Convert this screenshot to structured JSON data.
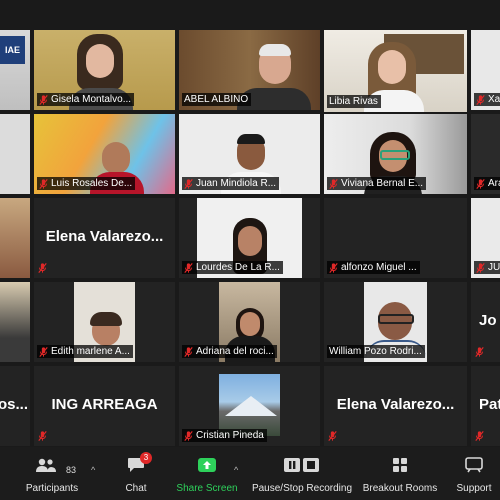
{
  "tiles": {
    "r1c0": {
      "label": ""
    },
    "r1c1": {
      "label": "Gisela Montalvo..."
    },
    "r1c2": {
      "label": "ABEL ALBINO"
    },
    "r1c3": {
      "label": "Libia Rivas"
    },
    "r1c4": {
      "label": "Xa"
    },
    "r2c1": {
      "label": "Luis Rosales De..."
    },
    "r2c2": {
      "label": "Juan Mindiola R..."
    },
    "r2c3": {
      "label": "Viviana Bernal E..."
    },
    "r2c4": {
      "label": "Ara"
    },
    "r3c1": {
      "name": "Elena Valarezo..."
    },
    "r3c2": {
      "label": "Lourdes De La R..."
    },
    "r3c3": {
      "label": "alfonzo Miguel ..."
    },
    "r3c4": {
      "label": "JU"
    },
    "r4c1": {
      "label": "Edith marlene A..."
    },
    "r4c2": {
      "label": "Adriana del roci..."
    },
    "r4c3": {
      "label": "William Pozo Rodri..."
    },
    "r4c4": {
      "name": "Jo"
    },
    "r5c0": {
      "name": "os..."
    },
    "r5c1": {
      "name": "ING ARREAGA"
    },
    "r5c2": {
      "label": "Cristian Pineda"
    },
    "r5c3": {
      "name": "Elena Valarezo..."
    },
    "r5c4": {
      "name": "Pat"
    },
    "r1c0_logo": "IAE"
  },
  "toolbar": {
    "participants_label": "Participants",
    "participants_count": "83",
    "chat_label": "Chat",
    "chat_badge": "3",
    "share_label": "Share Screen",
    "record_label": "Pause/Stop Recording",
    "breakout_label": "Breakout Rooms",
    "support_label": "Support"
  },
  "colors": {
    "active_speaker": "#c8e23a",
    "share_green": "#2ed15b",
    "muted_red": "#e02828"
  }
}
